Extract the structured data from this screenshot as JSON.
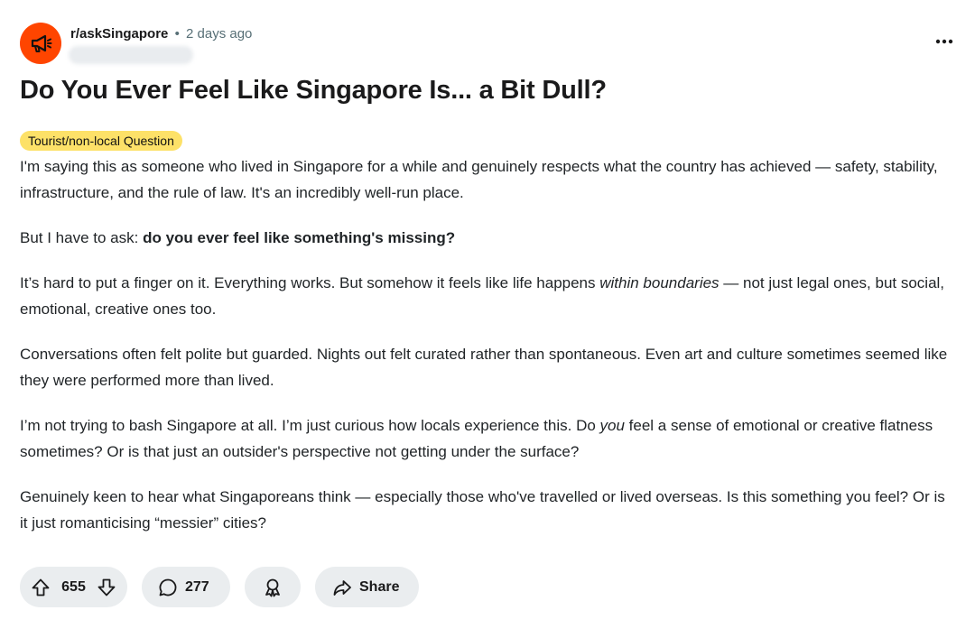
{
  "post": {
    "subreddit": "r/askSingapore",
    "separator": "•",
    "time": "2 days ago",
    "title": "Do You Ever Feel Like Singapore Is... a Bit Dull?",
    "flair": "Tourist/non-local Question",
    "flair_color": "#fde168",
    "avatar_color": "#ff4500",
    "body": {
      "p1": "I'm saying this as someone who lived in Singapore for a while and genuinely respects what the country has achieved — safety, stability, infrastructure, and the rule of law. It's an incredibly well-run place.",
      "p2_a": "But I have to ask: ",
      "p2_b": "do you ever feel like something's missing?",
      "p3_a": "It’s hard to put a finger on it. Everything works. But somehow it feels like life happens ",
      "p3_em": "within boundaries",
      "p3_b": " — not just legal ones, but social, emotional, creative ones too.",
      "p4": "Conversations often felt polite but guarded. Nights out felt curated rather than spontaneous. Even art and culture sometimes seemed like they were performed more than lived.",
      "p5_a": "I’m not trying to bash Singapore at all. I’m just curious how locals experience this. Do ",
      "p5_em": "you",
      "p5_b": " feel a sense of emotional or creative flatness sometimes? Or is that just an outsider's perspective not getting under the surface?",
      "p6": "Genuinely keen to hear what Singaporeans think — especially those who've travelled or lived overseas. Is this something you feel? Or is it just romanticising “messier” cities?"
    }
  },
  "actions": {
    "votes": "655",
    "comments": "277",
    "share_label": "Share"
  },
  "icons": {
    "avatar": "megaphone-icon",
    "more": "more-options-icon",
    "upvote": "upvote-arrow-icon",
    "downvote": "downvote-arrow-icon",
    "comment": "comment-bubble-icon",
    "award": "award-icon",
    "share": "share-arrow-icon"
  }
}
